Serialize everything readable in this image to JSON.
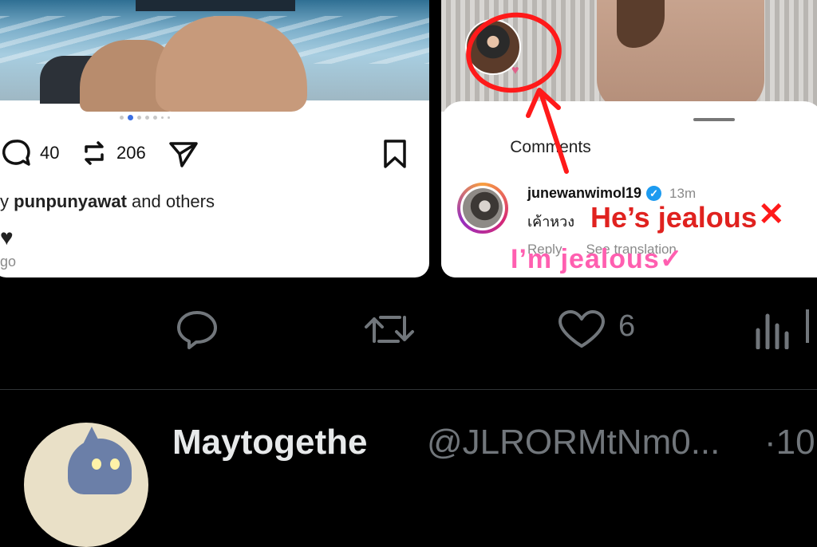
{
  "left_post": {
    "comment_count": "40",
    "repost_count": "206",
    "liked_by_user": "punpunyawat",
    "liked_by_prefix": "y",
    "liked_by_suffix": "and others",
    "heart": "♥",
    "time_ago": "go"
  },
  "right_post": {
    "comments_title": "Comments",
    "comment": {
      "username": "junewanwimol19",
      "verified": "✓",
      "time": "13m",
      "text": "เค้าหวง",
      "reply_label": "Reply",
      "translate_label": "See translation"
    },
    "story_heart": "♥"
  },
  "annotations": {
    "wrong_translation": "He’s jealous",
    "cross": "✕",
    "correct_translation": "I’m jealous",
    "check": "✓"
  },
  "tweet_actions": {
    "like_count": "6"
  },
  "next_tweet": {
    "display_name": "Maytogethe",
    "handle": "@JLRORMtNm0...",
    "time_fragment": "·10"
  },
  "colors": {
    "annotation_red": "#ff1a1a",
    "annotation_pink": "#ff5fb0",
    "verified_blue": "#1d9bf0",
    "twitter_gray": "#71767b"
  }
}
